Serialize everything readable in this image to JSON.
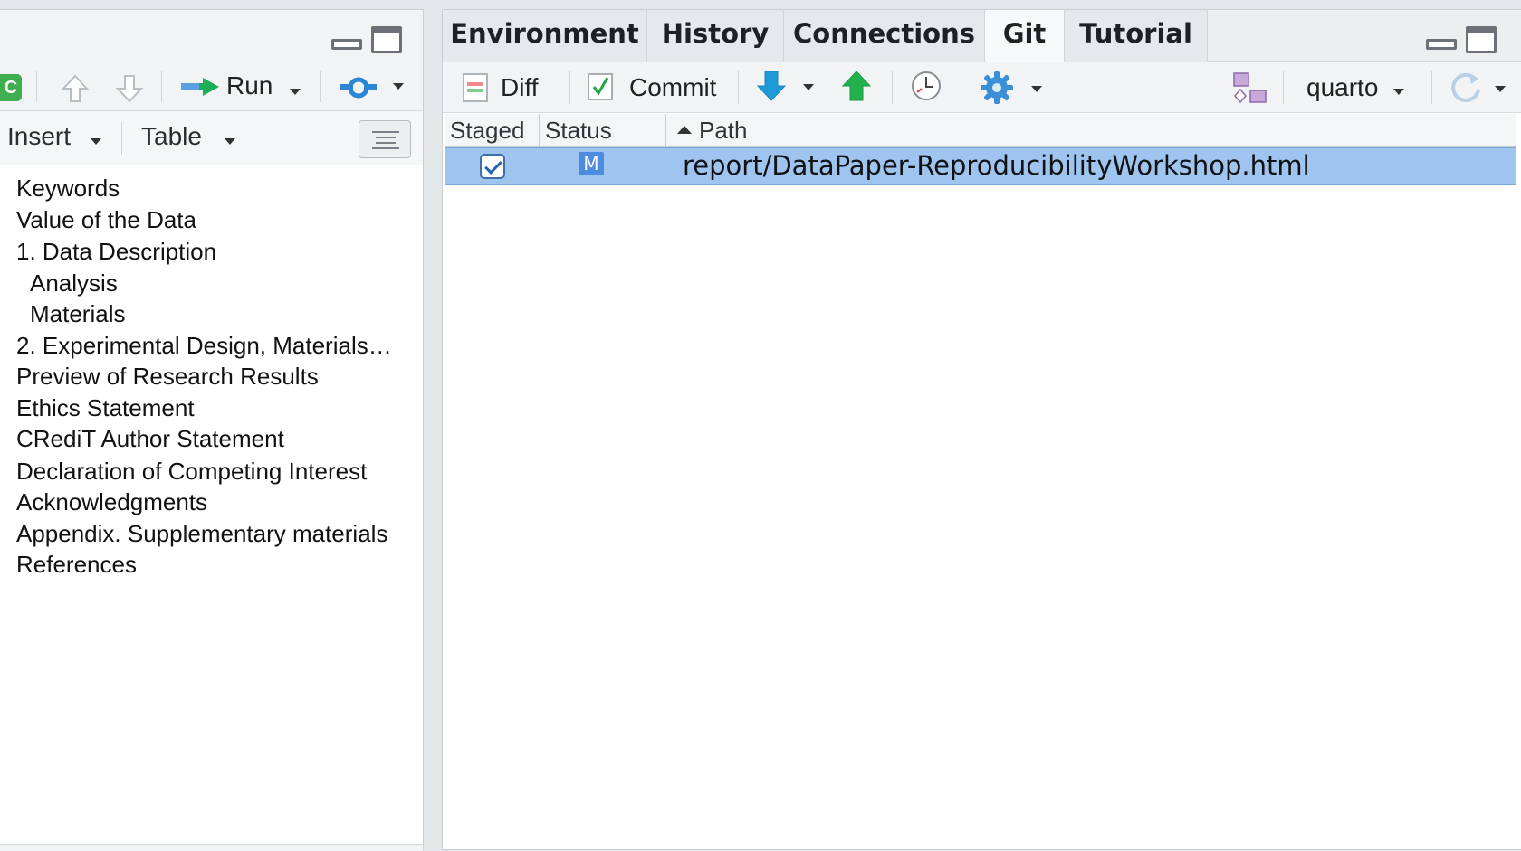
{
  "left": {
    "toolbar": {
      "run_label": "Run"
    },
    "formatbar": {
      "insert_label": "Insert",
      "table_label": "Table"
    },
    "outline": [
      {
        "label": "Keywords",
        "indent": false
      },
      {
        "label": "Value of the Data",
        "indent": false
      },
      {
        "label": "1. Data Description",
        "indent": false
      },
      {
        "label": "Analysis",
        "indent": true
      },
      {
        "label": "Materials",
        "indent": true
      },
      {
        "label": "2. Experimental Design, Materials…",
        "indent": false
      },
      {
        "label": "Preview of Research Results",
        "indent": false
      },
      {
        "label": "Ethics Statement",
        "indent": false
      },
      {
        "label": "CRediT Author Statement",
        "indent": false
      },
      {
        "label": "Declaration of Competing Interest",
        "indent": false
      },
      {
        "label": "Acknowledgments",
        "indent": false
      },
      {
        "label": "Appendix. Supplementary materials",
        "indent": false
      },
      {
        "label": "References",
        "indent": false
      }
    ]
  },
  "right": {
    "tabs": [
      "Environment",
      "History",
      "Connections",
      "Git",
      "Tutorial"
    ],
    "active_tab": "Git",
    "toolbar": {
      "diff_label": "Diff",
      "commit_label": "Commit",
      "branch_label": "quarto"
    },
    "table": {
      "headers": {
        "staged": "Staged",
        "status": "Status",
        "path": "Path"
      },
      "rows": [
        {
          "staged": true,
          "status": "M",
          "path": "report/DataPaper-ReproducibilityWorkshop.html"
        }
      ]
    }
  },
  "colors": {
    "selected_row": "#9fc4ef",
    "status_modified": "#4d8be0",
    "push_green": "#22b14c",
    "pull_blue": "#1e9bd7"
  }
}
